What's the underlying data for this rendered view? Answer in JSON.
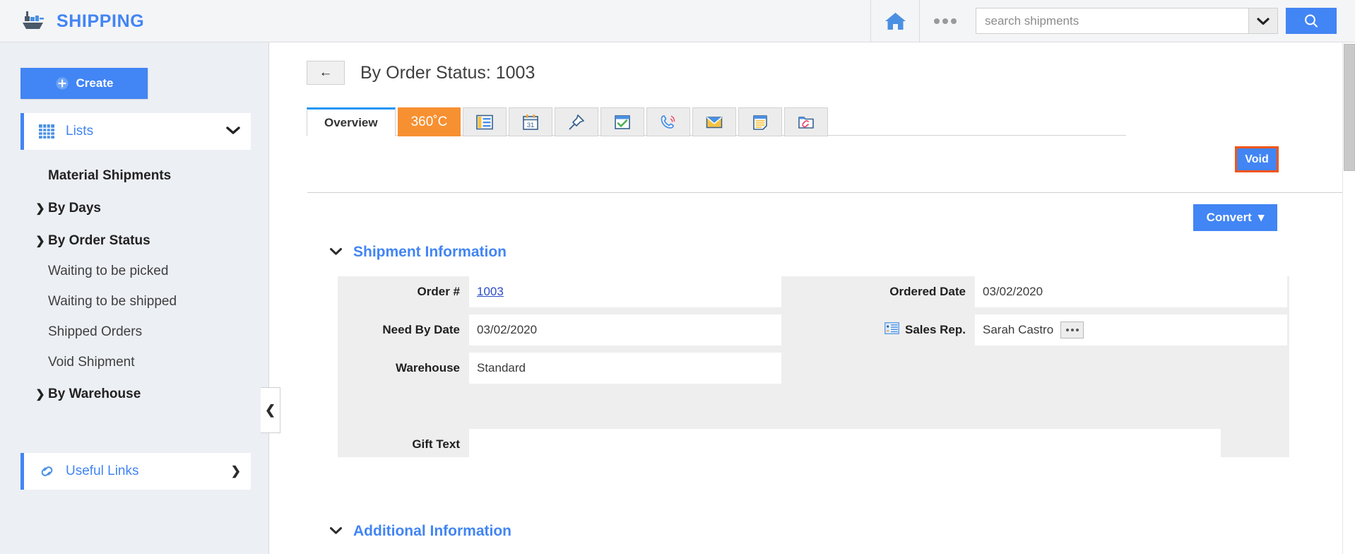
{
  "topbar": {
    "brand": "SHIPPING",
    "brand_icon": "ship-icon",
    "home_icon": "home-icon",
    "more_icon": "ellipsis-icon",
    "search": {
      "placeholder": "search shipments",
      "value": "",
      "dropdown_icon": "chevron-down-icon",
      "button_icon": "search-icon"
    },
    "colors": {
      "accent": "#4285f4",
      "bg": "#f4f5f7"
    }
  },
  "sidebar": {
    "create_label": "Create",
    "create_icon": "plus-circle-icon",
    "lists": {
      "label": "Lists",
      "icon": "grid-icon",
      "chevron": "chevron-down-icon"
    },
    "items": [
      {
        "label": "Material Shipments",
        "type": "leaf",
        "bold": true
      },
      {
        "label": "By Days",
        "type": "group",
        "chevron": "chevron-right-icon",
        "expanded": false
      },
      {
        "label": "By Order Status",
        "type": "group",
        "chevron": "chevron-down-icon",
        "expanded": true
      },
      {
        "label": "Waiting to be picked",
        "type": "leaf",
        "bold": false
      },
      {
        "label": "Waiting to be shipped",
        "type": "leaf",
        "bold": false
      },
      {
        "label": "Shipped Orders",
        "type": "leaf",
        "bold": false
      },
      {
        "label": "Void Shipment",
        "type": "leaf",
        "bold": false
      },
      {
        "label": "By Warehouse",
        "type": "group",
        "chevron": "chevron-right-icon",
        "expanded": false
      }
    ],
    "useful_links": {
      "label": "Useful Links",
      "icon": "link-icon",
      "chevron": "chevron-right-icon"
    },
    "collapse_handle_icon": "chevron-left-icon"
  },
  "main": {
    "back_icon": "arrow-left-icon",
    "page_title": "By Order Status: 1003",
    "tabs": [
      {
        "label": "Overview",
        "kind": "text",
        "active": true
      },
      {
        "label": "360˚C",
        "kind": "badge",
        "icon": "360-refresh-icon",
        "active": false
      },
      {
        "label": "",
        "kind": "icon",
        "icon": "contact-card-icon",
        "active": false
      },
      {
        "label": "",
        "kind": "icon",
        "icon": "calendar-icon",
        "active": false
      },
      {
        "label": "",
        "kind": "icon",
        "icon": "pin-icon",
        "active": false
      },
      {
        "label": "",
        "kind": "icon",
        "icon": "task-checkbox-icon",
        "active": false
      },
      {
        "label": "",
        "kind": "icon",
        "icon": "phone-call-icon",
        "active": false
      },
      {
        "label": "",
        "kind": "icon",
        "icon": "email-envelope-icon",
        "active": false
      },
      {
        "label": "",
        "kind": "icon",
        "icon": "notes-icon",
        "active": false
      },
      {
        "label": "",
        "kind": "icon",
        "icon": "attachment-folder-icon",
        "active": false
      }
    ],
    "void_button": {
      "label": "Void",
      "highlight_color": "#f4550d",
      "bg": "#4285f4"
    },
    "convert_button": {
      "label": "Convert",
      "caret_icon": "caret-down-icon"
    },
    "sections": [
      {
        "title": "Shipment Information",
        "chevron": "chevron-down-icon",
        "expanded": true,
        "left_fields": [
          {
            "label": "Order #",
            "value": "1003",
            "is_link": true
          },
          {
            "label": "Need By Date",
            "value": "03/02/2020",
            "is_link": false
          },
          {
            "label": "Warehouse",
            "value": "Standard",
            "is_link": false
          }
        ],
        "right_fields": [
          {
            "label": "Ordered Date",
            "value": "03/02/2020",
            "icon": null
          },
          {
            "label": "Sales Rep.",
            "value": "Sarah Castro",
            "icon": "contact-card-icon",
            "has_lookup": true
          }
        ],
        "full_fields": [
          {
            "label": "Gift Text",
            "value": ""
          }
        ]
      },
      {
        "title": "Additional Information",
        "chevron": "chevron-down-icon",
        "expanded": true
      }
    ]
  }
}
